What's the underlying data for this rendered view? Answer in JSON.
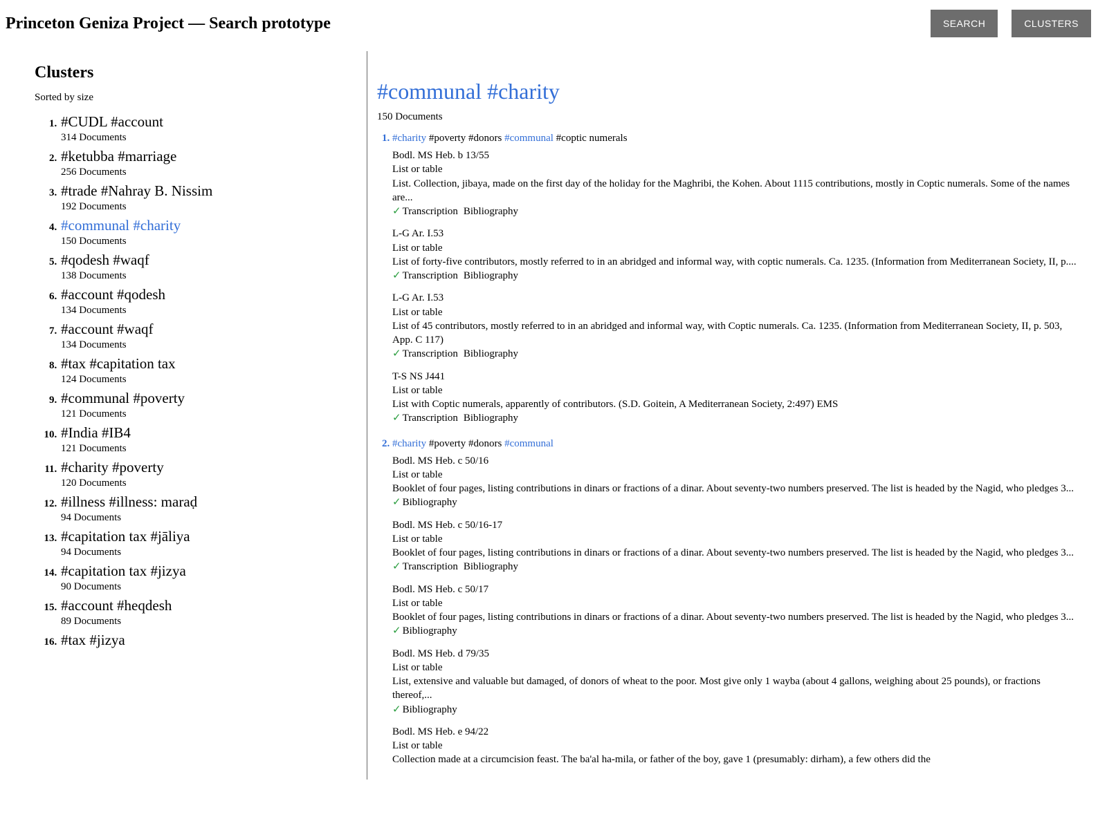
{
  "header": {
    "title": "Princeton Geniza Project — Search prototype",
    "search_btn": "SEARCH",
    "clusters_btn": "CLUSTERS"
  },
  "left": {
    "title": "Clusters",
    "sorted": "Sorted by size",
    "items": [
      {
        "name": "#CUDL #account",
        "count": "314 Documents",
        "active": false
      },
      {
        "name": "#ketubba #marriage",
        "count": "256 Documents",
        "active": false
      },
      {
        "name": "#trade #Nahray B. Nissim",
        "count": "192 Documents",
        "active": false
      },
      {
        "name": "#communal #charity",
        "count": "150 Documents",
        "active": true
      },
      {
        "name": "#qodesh #waqf",
        "count": "138 Documents",
        "active": false
      },
      {
        "name": "#account #qodesh",
        "count": "134 Documents",
        "active": false
      },
      {
        "name": "#account #waqf",
        "count": "134 Documents",
        "active": false
      },
      {
        "name": "#tax #capitation tax",
        "count": "124 Documents",
        "active": false
      },
      {
        "name": "#communal #poverty",
        "count": "121 Documents",
        "active": false
      },
      {
        "name": "#India #IB4",
        "count": "121 Documents",
        "active": false
      },
      {
        "name": "#charity #poverty",
        "count": "120 Documents",
        "active": false
      },
      {
        "name": "#illness #illness: maraḍ",
        "count": "94 Documents",
        "active": false
      },
      {
        "name": "#capitation tax #jāliya",
        "count": "94 Documents",
        "active": false
      },
      {
        "name": "#capitation tax #jizya",
        "count": "90 Documents",
        "active": false
      },
      {
        "name": "#account #heqdesh",
        "count": "89 Documents",
        "active": false
      },
      {
        "name": "#tax #jizya",
        "count": "",
        "active": false
      }
    ]
  },
  "right": {
    "title": "#communal #charity",
    "count": "150 Documents",
    "results": [
      {
        "tags": [
          {
            "text": "#charity",
            "link": true
          },
          {
            "text": "#poverty",
            "link": false
          },
          {
            "text": "#donors",
            "link": false
          },
          {
            "text": "#communal",
            "link": true
          },
          {
            "text": "#coptic numerals",
            "link": false
          }
        ],
        "docs": [
          {
            "shelfmark": "Bodl. MS Heb. b 13/55",
            "type": "List or table",
            "desc": "List. Collection, jibaya, made on the first day of the holiday for the Maghribi, the Kohen. About 1115 contributions, mostly in Coptic numerals. Some of the names are...",
            "meta": [
              "Transcription",
              "Bibliography"
            ]
          },
          {
            "shelfmark": "L-G Ar. I.53",
            "type": "List or table",
            "desc": "List of forty-five contributors, mostly referred to in an abridged and informal way, with coptic numerals. Ca. 1235. (Information from Mediterranean Society, II, p....",
            "meta": [
              "Transcription",
              "Bibliography"
            ]
          },
          {
            "shelfmark": "L-G Ar. I.53",
            "type": "List or table",
            "desc": "List of 45 contributors, mostly referred to in an abridged and informal way, with Coptic numerals. Ca. 1235. (Information from Mediterranean Society, II, p. 503, App. C 117)",
            "meta": [
              "Transcription",
              "Bibliography"
            ]
          },
          {
            "shelfmark": "T-S NS J441",
            "type": "List or table",
            "desc": "List with Coptic numerals, apparently of contributors. (S.D. Goitein, A Mediterranean Society, 2:497) EMS",
            "meta": [
              "Transcription",
              "Bibliography"
            ]
          }
        ]
      },
      {
        "tags": [
          {
            "text": "#charity",
            "link": true
          },
          {
            "text": "#poverty",
            "link": false
          },
          {
            "text": "#donors",
            "link": false
          },
          {
            "text": "#communal",
            "link": true
          }
        ],
        "docs": [
          {
            "shelfmark": "Bodl. MS Heb. c 50/16",
            "type": "List or table",
            "desc": "Booklet of four pages, listing contributions in dinars or fractions of a dinar. About seventy-two numbers preserved. The list is headed by the Nagid, who pledges 3...",
            "meta": [
              "Bibliography"
            ]
          },
          {
            "shelfmark": "Bodl. MS Heb. c 50/16-17",
            "type": "List or table",
            "desc": "Booklet of four pages, listing contributions in dinars or fractions of a dinar. About seventy-two numbers preserved. The list is headed by the Nagid, who pledges 3...",
            "meta": [
              "Transcription",
              "Bibliography"
            ]
          },
          {
            "shelfmark": "Bodl. MS Heb. c 50/17",
            "type": "List or table",
            "desc": "Booklet of four pages, listing contributions in dinars or fractions of a dinar. About seventy-two numbers preserved. The list is headed by the Nagid, who pledges 3...",
            "meta": [
              "Bibliography"
            ]
          },
          {
            "shelfmark": "Bodl. MS Heb. d 79/35",
            "type": "List or table",
            "desc": "List, extensive and valuable but damaged, of donors of wheat to the poor. Most give only 1 wayba (about 4 gallons, weighing about 25 pounds), or fractions thereof,...",
            "meta": [
              "Bibliography"
            ]
          },
          {
            "shelfmark": "Bodl. MS Heb. e 94/22",
            "type": "List or table",
            "desc": "Collection made at a circumcision feast. The ba'al ha-mila, or father of the boy, gave 1 (presumably: dirham), a few others did the",
            "meta": []
          }
        ]
      }
    ]
  }
}
